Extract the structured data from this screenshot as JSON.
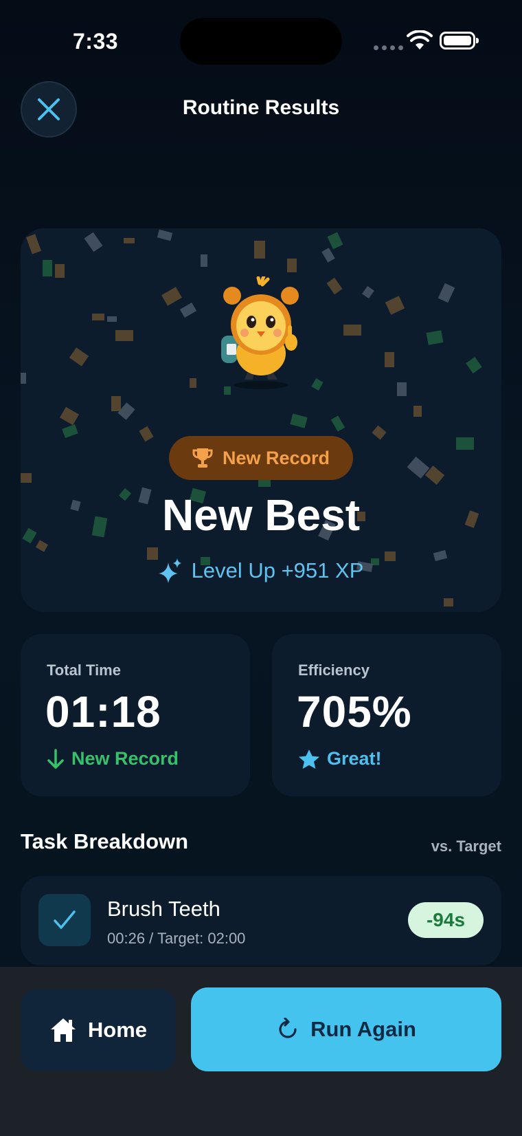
{
  "status_bar": {
    "time": "7:33"
  },
  "header": {
    "title": "Routine Results",
    "close_icon": "close-icon"
  },
  "hero": {
    "badge_label": "New Record",
    "badge_icon": "trophy-icon",
    "title": "New Best",
    "xp_label": "Level Up +951 XP",
    "xp_icon": "sparkle-icon",
    "mascot": "alarm-clock-chick-mascot"
  },
  "stats": {
    "total_time": {
      "caption": "Total Time",
      "value": "01:18",
      "sub_label": "New Record",
      "sub_icon": "arrow-down-icon"
    },
    "efficiency": {
      "caption": "Efficiency",
      "value": "705%",
      "sub_label": "Great!",
      "sub_icon": "star-icon"
    }
  },
  "breakdown": {
    "title": "Task Breakdown",
    "aux": "vs. Target",
    "tasks": [
      {
        "name": "Brush Teeth",
        "meta": "00:26 / Target: 02:00",
        "delta": "-94s",
        "done": true
      }
    ]
  },
  "actions": {
    "home_label": "Home",
    "home_icon": "home-icon",
    "run_label": "Run Again",
    "run_icon": "refresh-icon"
  },
  "colors": {
    "background": "#06111c",
    "card": "#0c1c2c",
    "accent": "#45c3ef",
    "success": "#35c26a",
    "record_orange": "#f5a04a"
  }
}
